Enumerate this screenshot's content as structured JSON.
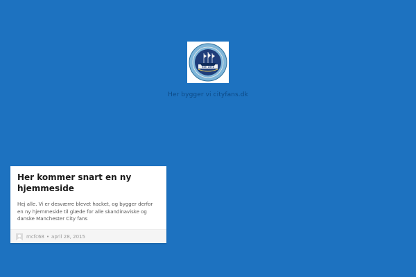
{
  "header": {
    "logo_icon": "club-crest-icon",
    "logo_crest_text": "EST. 1974",
    "tagline": "Her bygger vi cityfans.dk"
  },
  "posts": [
    {
      "title": "Her kommer snart en ny hjemmeside",
      "excerpt": "Hej alle. Vi er desværre blevet hacket, og bygger derfor en ny hjemmeside til glæde for alle skandinaviske og danske Manchester City fans",
      "author": "mcfc68",
      "separator": "•",
      "date": "april 28, 2015"
    }
  ],
  "colors": {
    "background": "#1d72c0",
    "card": "#ffffff",
    "meta_bar": "#f5f5f5"
  }
}
